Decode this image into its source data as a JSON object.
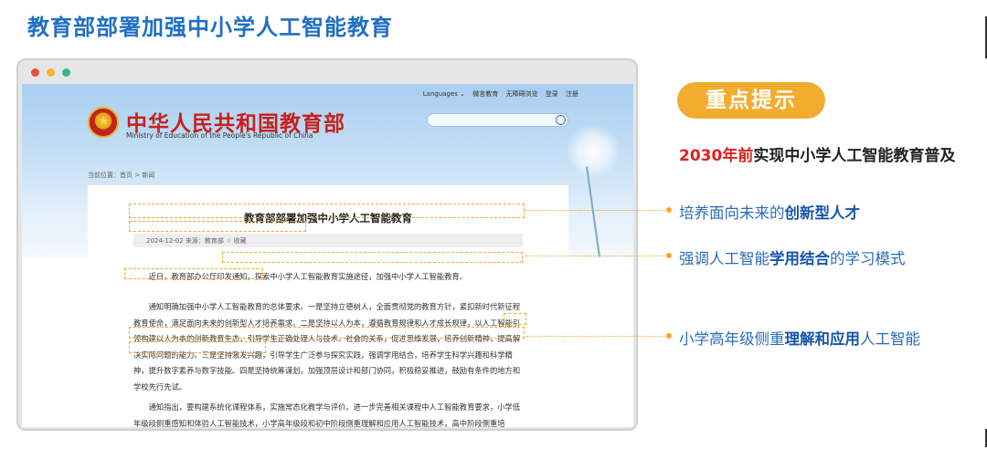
{
  "slide": {
    "title": "教育部部署加强中小学人工智能教育"
  },
  "browser": {
    "site": {
      "top_links": [
        "Languages ⌄",
        "微言教育",
        "无障碍浏览",
        "登录",
        "注册"
      ],
      "name": "中华人民共和国教育部",
      "name_en": "Ministry of Education of the People's Republic of China",
      "breadcrumb": "当前位置：首页 > 新闻"
    },
    "article": {
      "title": "教育部部署加强中小学人工智能教育",
      "meta": "2024-12-02  来源：教育部   ☆ 收藏",
      "p1": "近日，教育部办公厅印发通知，探索中小学人工智能教育实施途径，加强中小学人工智能教育。",
      "p2": "通知明确加强中小学人工智能教育的总体要求。一是坚持立德树人，全面贯彻党的教育方针，紧扣新时代新征程教育使命，满足面向未来的创新型人才培养需求。二是坚持以人为本，遵循教育规律和人才成长规律，以人工智能引领构建以人为本的创新教育生态，引导学生正确处理人与技术、社会的关系，促进思维发展，培养创新精神，提高解决实际问题的能力。三是坚持激发兴趣，引导学生广泛参与探究实践，强调学用结合，培养学生科学兴趣和科学精神，提升数字素养与数字技能。四是坚持统筹谋划，加强顶层设计和部门协同，积极稳妥推进，鼓励有条件的地方和学校先行先试。",
      "p3": "通知指出，要构建系统化课程体系，实施常态化教学与评价。进一步完善相关课程中人工智能教育要求，小学低年级段侧重感知和体验人工智能技术，小学高年级段和初中阶段侧重理解和应用人工智能技术，高中阶段侧重培"
    }
  },
  "panel": {
    "badge": "重点提示",
    "headline_red": "2030年前",
    "headline_rest": "实现中小学人工智能教育普及",
    "points": [
      {
        "pre": "培养面向未来的",
        "bold": "创新型人才",
        "post": ""
      },
      {
        "pre": "强调人工智能",
        "bold": "学用结合",
        "post": "的学习模式"
      },
      {
        "pre": "小学高年级侧重",
        "bold": "理解和应用",
        "post": "人工智能"
      }
    ]
  },
  "colors": {
    "title_blue": "#1f6fc4",
    "accent_orange": "#f2ad2f",
    "emphasis_red": "#e02020",
    "site_red": "#c8201a"
  }
}
